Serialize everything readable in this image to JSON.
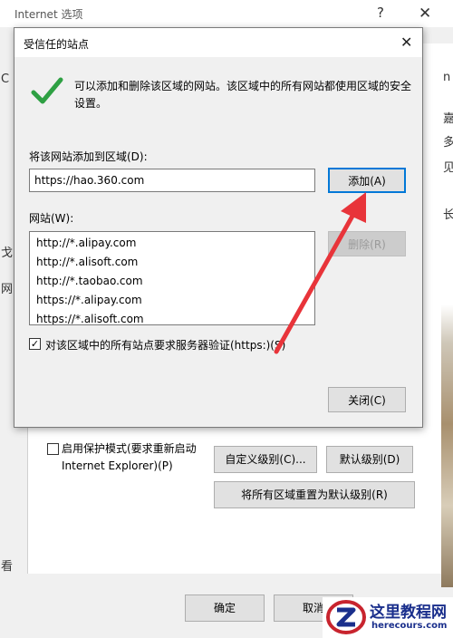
{
  "outer": {
    "title": "Internet 选项",
    "help_icon": "?",
    "close_icon": "✕",
    "left_edge_chars": [
      "C",
      "戈",
      "网",
      "看"
    ],
    "right_edge_chars": [
      "n",
      "嘉",
      "多",
      "见",
      "长"
    ],
    "protected_mode_label_line1": "启用保护模式(要求重新启动",
    "protected_mode_label_line2": "Internet Explorer)(P)",
    "protected_mode_checked": false,
    "custom_level_button": "自定义级别(C)...",
    "default_level_button": "默认级别(D)",
    "reset_all_button": "将所有区域重置为默认级别(R)",
    "ok_button": "确定",
    "cancel_button": "取消"
  },
  "dialog": {
    "title": "受信任的站点",
    "close_icon": "✕",
    "info_text": "可以添加和删除该区域的网站。该区域中的所有网站都使用区域的安全设置。",
    "add_label": "将该网站添加到区域(D):",
    "url_value": "https://hao.360.com",
    "add_button": "添加(A)",
    "sites_label": "网站(W):",
    "sites": [
      "http://*.alipay.com",
      "http://*.alisoft.com",
      "http://*.taobao.com",
      "https://*.alipay.com",
      "https://*.alisoft.com"
    ],
    "remove_button": "删除(R)",
    "require_https_label": "对该区域中的所有站点要求服务器验证(https:)(S)",
    "require_https_checked": true,
    "close_button": "关闭(C)"
  },
  "watermark": {
    "line1": "这里教程网",
    "line2": "herecours.com"
  },
  "colors": {
    "accent_blue": "#0078d7",
    "check_green": "#2ea043",
    "arrow_red": "#e8343a",
    "watermark_blue": "#1a2f8c"
  }
}
